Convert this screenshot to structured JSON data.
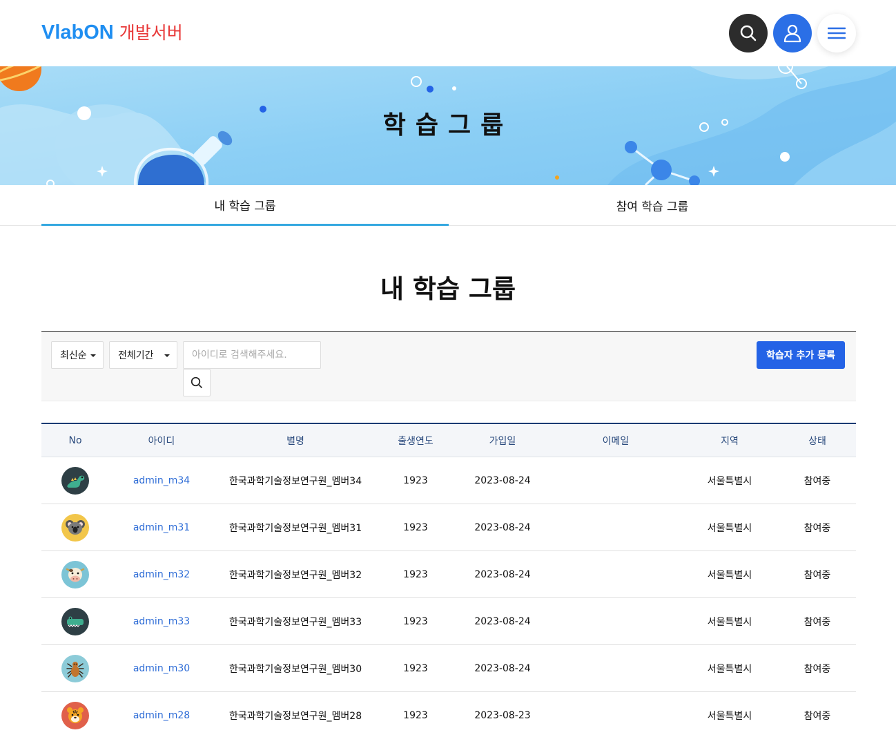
{
  "header": {
    "logo_brand": "VlabON",
    "logo_sub": "개발서버",
    "colors": {
      "brand": "#1f8ef1",
      "sub": "#e83838",
      "search_btn": "#2c2c2c",
      "user_btn": "#2b6fe6"
    }
  },
  "banner": {
    "title": "학습그룹"
  },
  "tabs": [
    {
      "label": "내 학습 그룹",
      "active": true
    },
    {
      "label": "참여 학습 그룹",
      "active": false
    }
  ],
  "section": {
    "title": "내 학습 그룹"
  },
  "filter": {
    "order_selected": "최신순",
    "period_selected": "전체기간",
    "search_placeholder": "아이디로 검색해주세요.",
    "add_button": "학습자 추가 등록"
  },
  "table": {
    "columns": [
      "No",
      "아이디",
      "별명",
      "출생연도",
      "가입일",
      "이메일",
      "지역",
      "상태"
    ],
    "rows": [
      {
        "avatar": "dinosaur-icon",
        "avatar_bg": "#2e3f45",
        "id": "admin_m34",
        "nick": "한국과학기술정보연구원_멤버34",
        "year": "1923",
        "joined": "2023-08-24",
        "email": "",
        "region": "서울특별시",
        "status": "참여중"
      },
      {
        "avatar": "koala-icon",
        "avatar_bg": "#f2c64a",
        "id": "admin_m31",
        "nick": "한국과학기술정보연구원_멤버31",
        "year": "1923",
        "joined": "2023-08-24",
        "email": "",
        "region": "서울특별시",
        "status": "참여중"
      },
      {
        "avatar": "cow-icon",
        "avatar_bg": "#7cc4d6",
        "id": "admin_m32",
        "nick": "한국과학기술정보연구원_멤버32",
        "year": "1923",
        "joined": "2023-08-24",
        "email": "",
        "region": "서울특별시",
        "status": "참여중"
      },
      {
        "avatar": "crocodile-icon",
        "avatar_bg": "#2e3f45",
        "id": "admin_m33",
        "nick": "한국과학기술정보연구원_멤버33",
        "year": "1923",
        "joined": "2023-08-24",
        "email": "",
        "region": "서울특별시",
        "status": "참여중"
      },
      {
        "avatar": "spider-icon",
        "avatar_bg": "#8ccbd8",
        "id": "admin_m30",
        "nick": "한국과학기술정보연구원_멤버30",
        "year": "1923",
        "joined": "2023-08-24",
        "email": "",
        "region": "서울특별시",
        "status": "참여중"
      },
      {
        "avatar": "tiger-icon",
        "avatar_bg": "#e0604a",
        "id": "admin_m28",
        "nick": "한국과학기술정보연구원_멤버28",
        "year": "1923",
        "joined": "2023-08-23",
        "email": "",
        "region": "서울특별시",
        "status": "참여중"
      }
    ]
  }
}
